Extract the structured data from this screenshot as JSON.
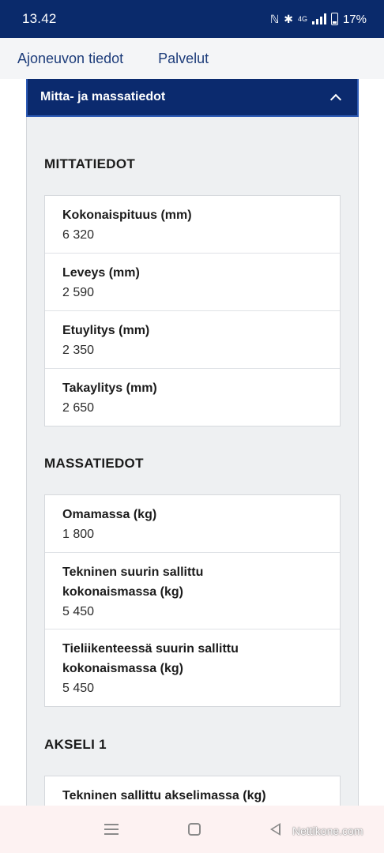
{
  "status_bar": {
    "time": "13.42",
    "network": "4G",
    "battery": "17%"
  },
  "nav": {
    "tabs": [
      "Ajoneuvon tiedot",
      "Palvelut"
    ]
  },
  "accordion": {
    "title": "Mitta- ja massatiedot"
  },
  "sections": {
    "mittatiedot": {
      "heading": "MITTATIEDOT",
      "rows": [
        {
          "label": "Kokonaispituus (mm)",
          "value": "6 320"
        },
        {
          "label": "Leveys (mm)",
          "value": "2 590"
        },
        {
          "label": "Etuylitys (mm)",
          "value": "2 350"
        },
        {
          "label": "Takaylitys (mm)",
          "value": "2 650"
        }
      ]
    },
    "massatiedot": {
      "heading": "MASSATIEDOT",
      "rows": [
        {
          "label": "Omamassa (kg)",
          "value": "1 800"
        },
        {
          "label": "Tekninen suurin sallittu kokonaismassa (kg)",
          "value": "5 450"
        },
        {
          "label": "Tieliikenteessä suurin sallittu kokonaismassa (kg)",
          "value": "5 450"
        }
      ]
    },
    "akseli1": {
      "heading": "AKSELI 1",
      "rows": [
        {
          "label": "Tekninen sallittu akselimassa (kg)"
        }
      ]
    }
  },
  "watermark": "Nettikone.com"
}
